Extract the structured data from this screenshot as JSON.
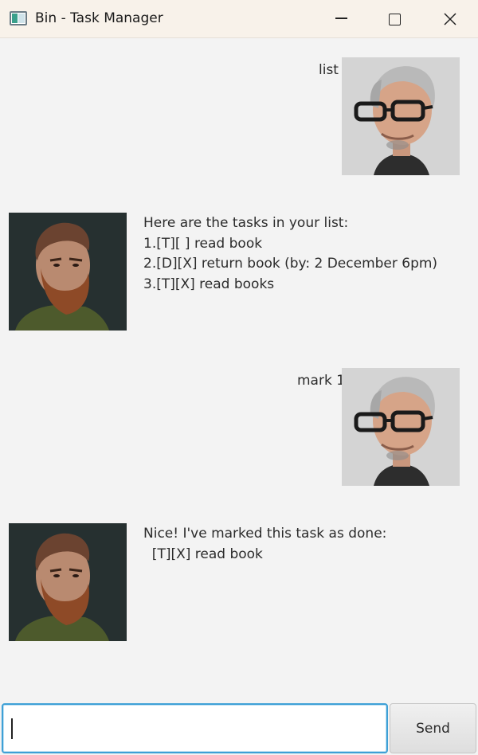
{
  "window": {
    "title": "Bin - Task Manager"
  },
  "messages": [
    {
      "sender": "user",
      "text": "list"
    },
    {
      "sender": "bot",
      "lines": [
        "Here are the tasks in your list:",
        "1.[T][ ] read book",
        "2.[D][X] return book (by: 2 December 6pm)",
        "3.[T][X] read books"
      ]
    },
    {
      "sender": "user",
      "text": "mark 1"
    },
    {
      "sender": "bot",
      "lines": [
        "Nice! I've marked this task as done:",
        "  [T][X] read book"
      ]
    }
  ],
  "input": {
    "value": "",
    "placeholder": ""
  },
  "send_label": "Send",
  "colors": {
    "titlebar": "#f8f2ea",
    "background": "#f3f3f3",
    "input_focus": "#3ea0d6"
  }
}
